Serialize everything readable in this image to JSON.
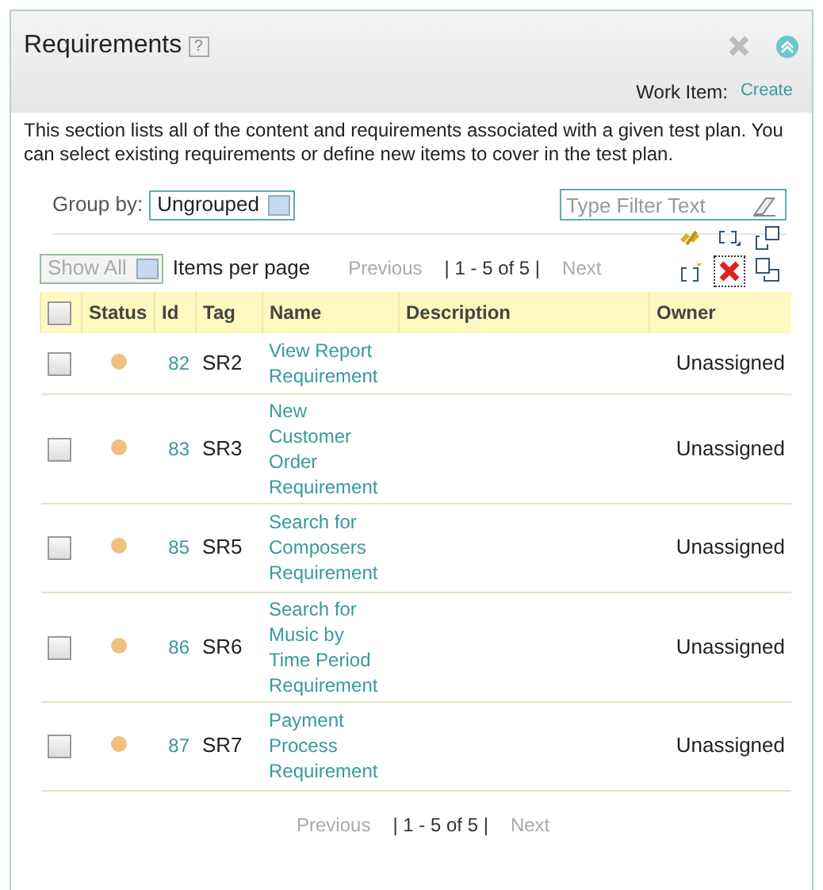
{
  "panel": {
    "title": "Requirements",
    "help": "?",
    "work_item_label": "Work Item:",
    "work_item_link": "Create",
    "description": "This section lists all of the content and requirements associated with a given test plan. You can select existing requirements or define new items to cover in the test plan."
  },
  "group_by": {
    "label": "Group by:",
    "value": "Ungrouped"
  },
  "filter": {
    "placeholder": "Type Filter Text"
  },
  "page_size": {
    "value": "Show All",
    "disabled": true,
    "label": "Items per page"
  },
  "pager_top": {
    "previous": "Previous",
    "previous_disabled": true,
    "range": "| 1 - 5 of 5 |",
    "next": "Next",
    "next_disabled": true
  },
  "table": {
    "columns": [
      "Status",
      "Id",
      "Tag",
      "Name",
      "Description",
      "Owner"
    ],
    "select_all_checked": false,
    "rows": [
      {
        "checked": false,
        "color": "#f0c080",
        "id": "82",
        "tag": "SR2",
        "name": "View Report Requirement",
        "description": "",
        "owner": "Unassigned"
      },
      {
        "checked": false,
        "color": "#f0c080",
        "id": "83",
        "tag": "SR3",
        "name": "New Customer Order Requirement",
        "description": "",
        "owner": "Unassigned"
      },
      {
        "checked": false,
        "color": "#f0c080",
        "id": "85",
        "tag": "SR5",
        "name": "Search for Composers Requirement",
        "description": "",
        "owner": "Unassigned"
      },
      {
        "checked": false,
        "color": "#f0c080",
        "id": "86",
        "tag": "SR6",
        "name": "Search for Music by Time Period Requirement",
        "description": "",
        "owner": "Unassigned"
      },
      {
        "checked": false,
        "color": "#f0c080",
        "id": "87",
        "tag": "SR7",
        "name": "Payment Process Requirement",
        "description": "",
        "owner": "Unassigned"
      }
    ]
  },
  "pager_bottom": {
    "previous": "Previous",
    "previous_disabled": true,
    "range": "| 1 - 5 of 5 |",
    "next": "Next",
    "next_disabled": true
  }
}
